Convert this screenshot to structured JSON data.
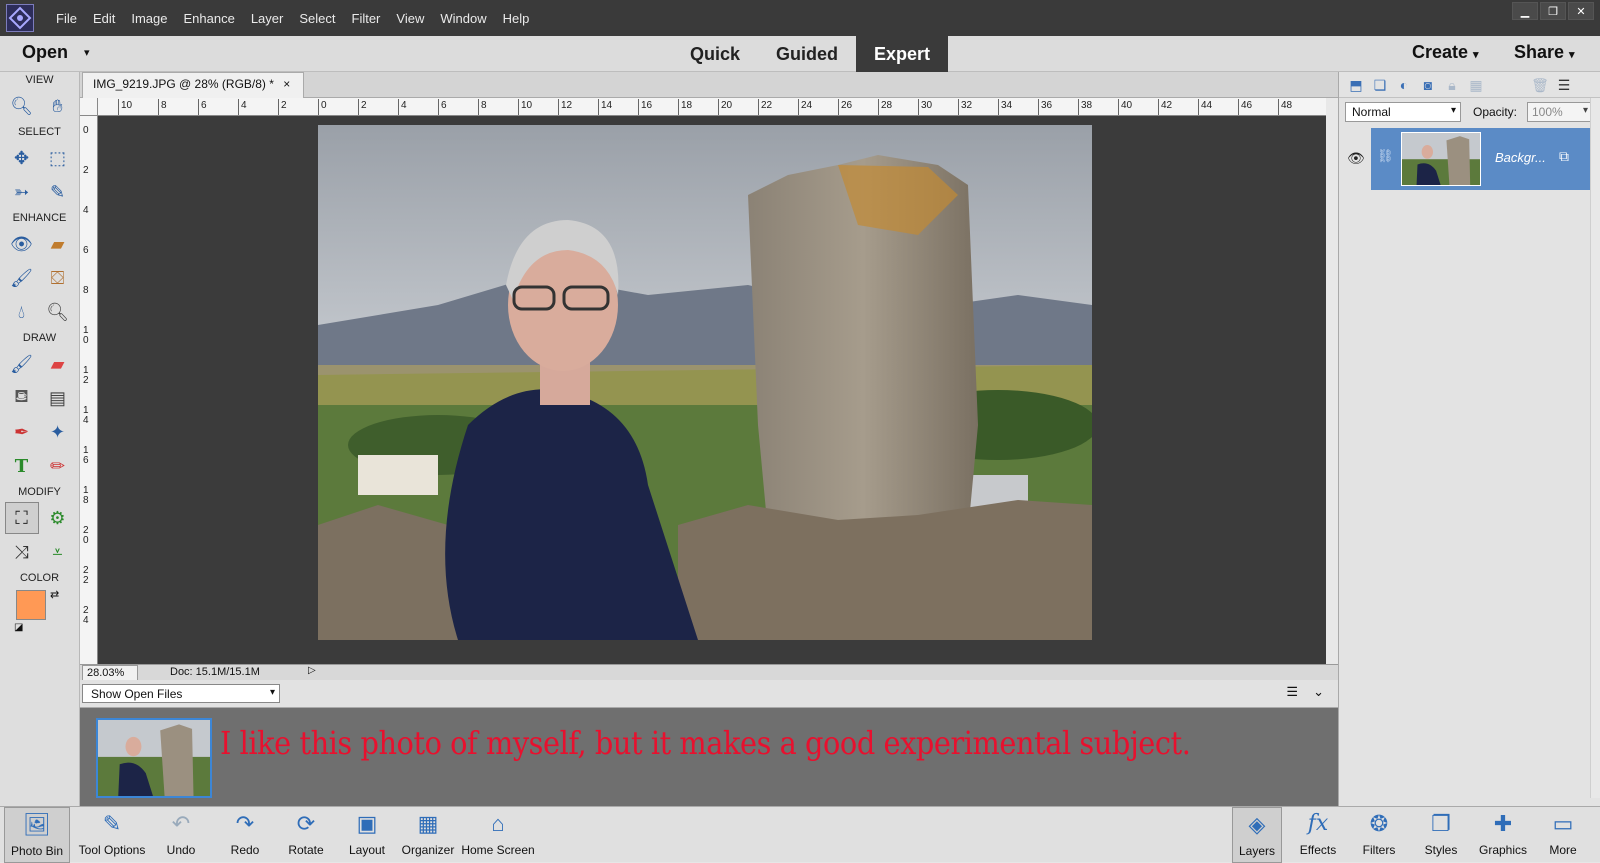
{
  "menubar": {
    "items": [
      "File",
      "Edit",
      "Image",
      "Enhance",
      "Layer",
      "Select",
      "Filter",
      "View",
      "Window",
      "Help"
    ],
    "window_controls": [
      "▁",
      "❐",
      "✕"
    ]
  },
  "modebar": {
    "open_label": "Open",
    "tabs": [
      {
        "label": "Quick"
      },
      {
        "label": "Guided"
      },
      {
        "label": "Expert"
      }
    ],
    "create_label": "Create",
    "share_label": "Share"
  },
  "toolbox": {
    "sections": {
      "view": "VIEW",
      "select": "SELECT",
      "enhance": "ENHANCE",
      "draw": "DRAW",
      "modify": "MODIFY",
      "color": "COLOR"
    },
    "foreground_color": "#ff9955",
    "background_color": "#ffffff"
  },
  "document": {
    "tab_title": "IMG_9219.JPG @ 28% (RGB/8) *",
    "tab_close": "×",
    "ruler_h": [
      "10",
      "8",
      "6",
      "4",
      "2",
      "0",
      "2",
      "4",
      "6",
      "8",
      "10",
      "12",
      "14",
      "16",
      "18",
      "20",
      "22",
      "24",
      "26",
      "28",
      "30",
      "32",
      "34",
      "36",
      "38",
      "40",
      "42",
      "44",
      "46",
      "48"
    ],
    "ruler_v": [
      "0",
      "2",
      "4",
      "6",
      "8",
      "10",
      "12",
      "14",
      "16",
      "18",
      "20",
      "22",
      "24"
    ],
    "zoom": "28.03%",
    "doc_size": "Doc: 15.1M/15.1M"
  },
  "photo_bin": {
    "filter_label": "Show Open Files",
    "caption": "I like this photo of myself, but it makes a good experimental subject."
  },
  "layers": {
    "blend_mode": "Normal",
    "opacity_label": "Opacity:",
    "opacity_value": "100%",
    "layer_name": "Backgr..."
  },
  "taskbar": {
    "left": [
      {
        "label": "Photo Bin",
        "icon": "photo-bin-icon"
      },
      {
        "label": "Tool Options",
        "icon": "tool-options-icon"
      },
      {
        "label": "Undo",
        "icon": "undo-icon"
      },
      {
        "label": "Redo",
        "icon": "redo-icon"
      },
      {
        "label": "Rotate",
        "icon": "rotate-icon"
      },
      {
        "label": "Layout",
        "icon": "layout-icon"
      },
      {
        "label": "Organizer",
        "icon": "organizer-icon"
      },
      {
        "label": "Home Screen",
        "icon": "home-screen-icon"
      }
    ],
    "right": [
      {
        "label": "Layers",
        "icon": "layers-icon"
      },
      {
        "label": "Effects",
        "icon": "effects-icon"
      },
      {
        "label": "Filters",
        "icon": "filters-icon"
      },
      {
        "label": "Styles",
        "icon": "styles-icon"
      },
      {
        "label": "Graphics",
        "icon": "graphics-icon"
      },
      {
        "label": "More",
        "icon": "more-icon"
      }
    ]
  },
  "colors": {
    "caption_red": "#e8102e",
    "layer_selected": "#5b8bc6",
    "accent_blue": "#2f6db8"
  }
}
